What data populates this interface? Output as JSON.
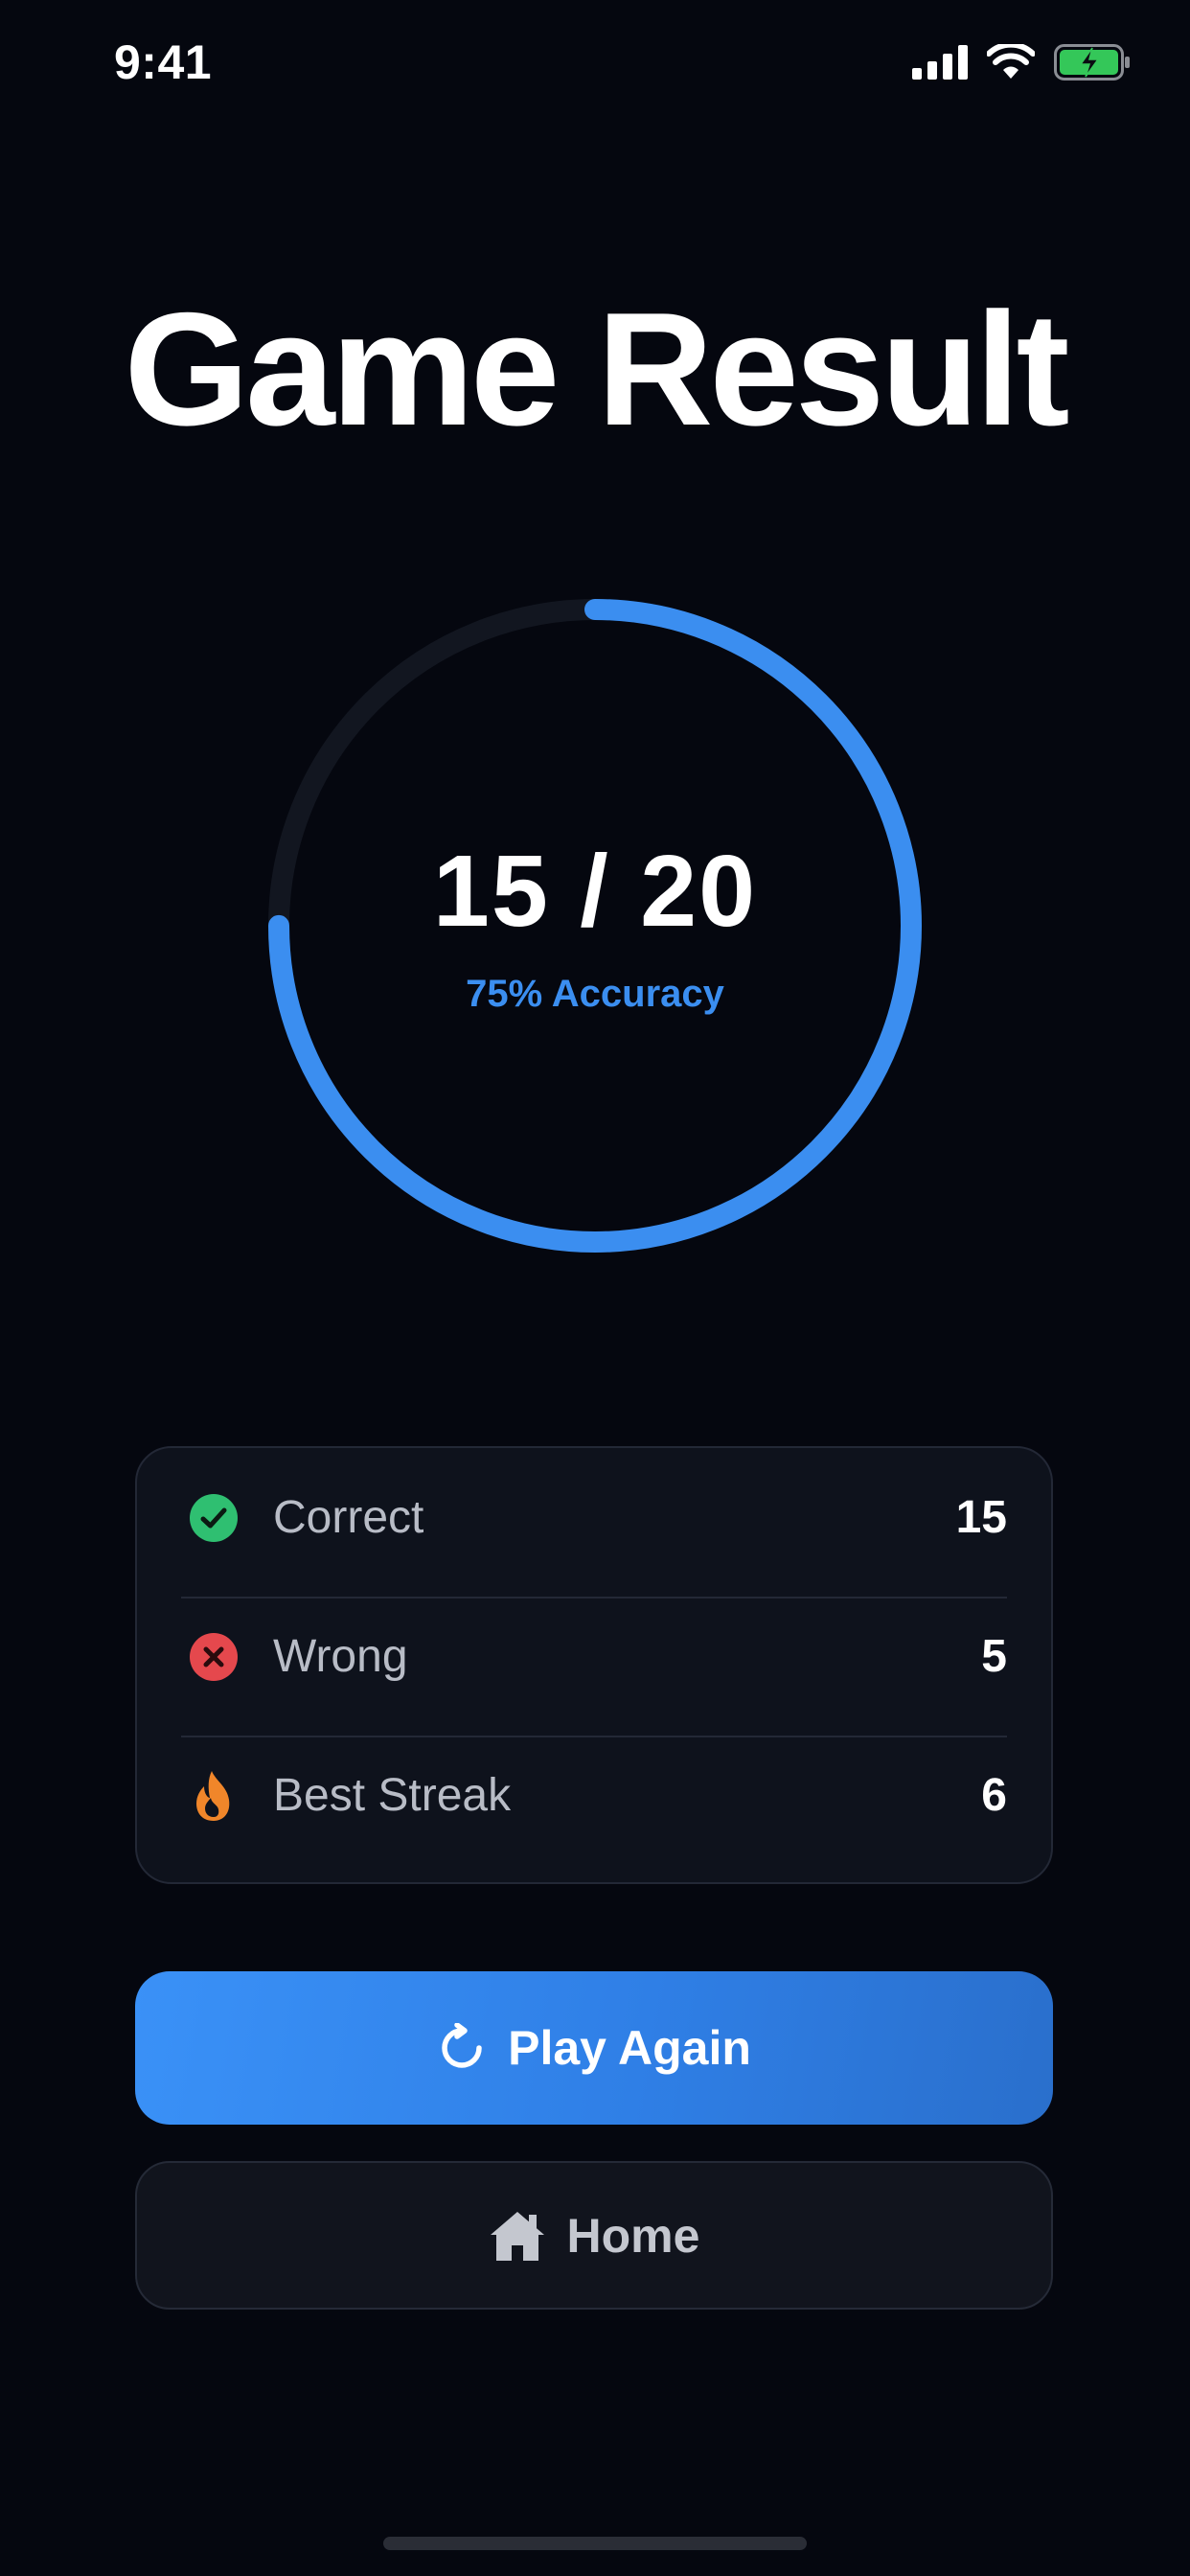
{
  "status_bar": {
    "time": "9:41",
    "icons": [
      "cellular-signal-icon",
      "wifi-icon",
      "battery-charging-icon"
    ]
  },
  "title": "Game Result",
  "result": {
    "score": "15 / 20",
    "accuracy": "75% Accuracy",
    "progress_fraction": 0.75,
    "ring_color": "#3b8ef0",
    "track_color": "#121620"
  },
  "stats": [
    {
      "icon": "check-circle-icon",
      "label": "Correct",
      "value": "15",
      "color": "#2fbf71"
    },
    {
      "icon": "x-circle-icon",
      "label": "Wrong",
      "value": "5",
      "color": "#e5484d"
    },
    {
      "icon": "flame-icon",
      "label": "Best Streak",
      "value": "6",
      "color": "#f0862a"
    }
  ],
  "buttons": {
    "play_again": {
      "label": "Play Again",
      "icon": "refresh-icon"
    },
    "home": {
      "label": "Home",
      "icon": "home-icon"
    }
  }
}
